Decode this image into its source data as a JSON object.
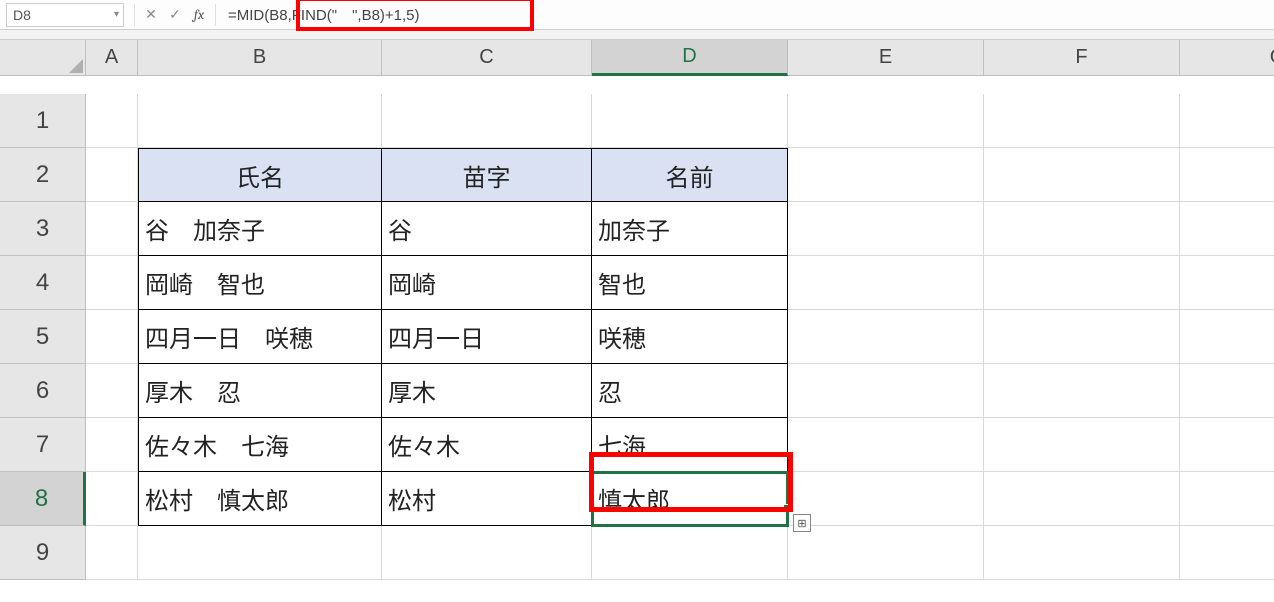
{
  "formula_bar": {
    "name_box": "D8",
    "formula": "=MID(B8,FIND(\"　\",B8)+1,5)"
  },
  "col_headers": [
    "A",
    "B",
    "C",
    "D",
    "E",
    "F",
    "G"
  ],
  "row_headers": [
    "1",
    "2",
    "3",
    "4",
    "5",
    "6",
    "7",
    "8",
    "9"
  ],
  "active_cell": {
    "row": 8,
    "col": "D"
  },
  "table": {
    "header": {
      "b": "氏名",
      "c": "苗字",
      "d": "名前"
    },
    "rows": [
      {
        "b": "谷　加奈子",
        "c": "谷",
        "d": "加奈子"
      },
      {
        "b": "岡崎　智也",
        "c": "岡崎",
        "d": "智也"
      },
      {
        "b": "四月一日　咲穂",
        "c": "四月一日",
        "d": "咲穂"
      },
      {
        "b": "厚木　忍",
        "c": "厚木",
        "d": "忍"
      },
      {
        "b": "佐々木　七海",
        "c": "佐々木",
        "d": "七海"
      },
      {
        "b": "松村　慎太郎",
        "c": "松村",
        "d": "慎太郎"
      }
    ]
  },
  "icons": {
    "cancel": "✕",
    "enter": "✓",
    "dropdown": "▾",
    "fx": "fx",
    "autofill": "⊞"
  }
}
